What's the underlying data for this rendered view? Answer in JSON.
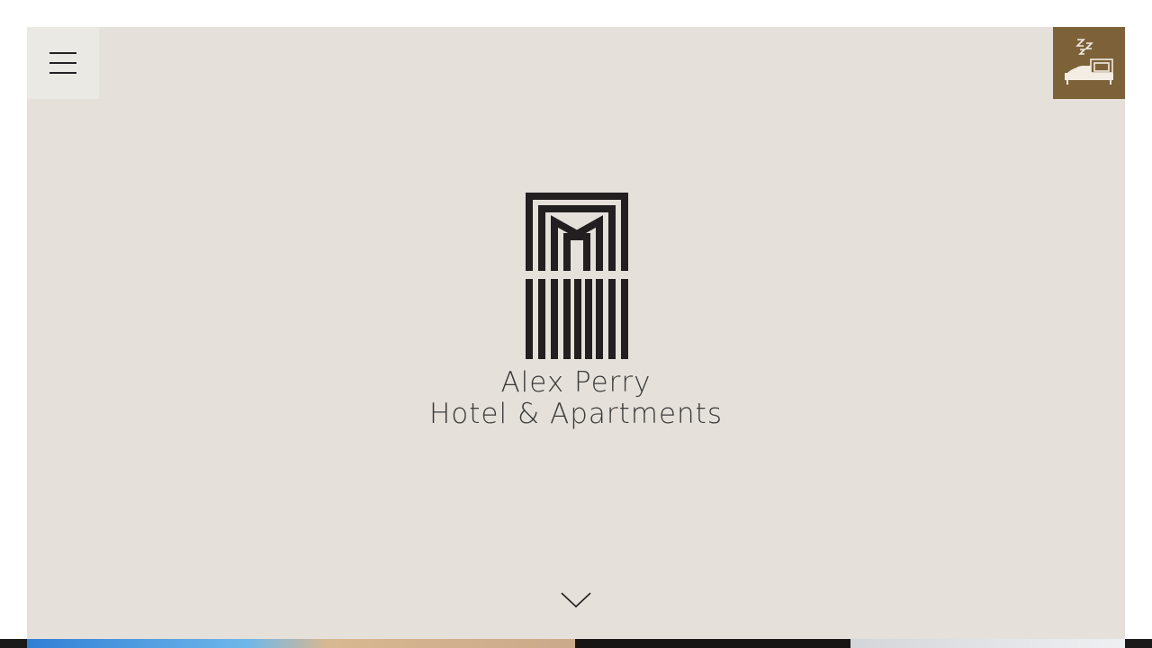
{
  "header": {
    "menu_label": "",
    "book_icon": "sleeping-bed-icon"
  },
  "brand": {
    "line1": "Alex Perry",
    "line2": "Hotel & Apartments",
    "logo_icon": "arch-logo"
  },
  "hero": {
    "scroll_icon": "chevron-down-icon"
  },
  "colors": {
    "hero_bg": "#e5e0da",
    "menu_bg": "#ebe9e3",
    "accent": "#7d6139",
    "logo": "#231f20"
  }
}
